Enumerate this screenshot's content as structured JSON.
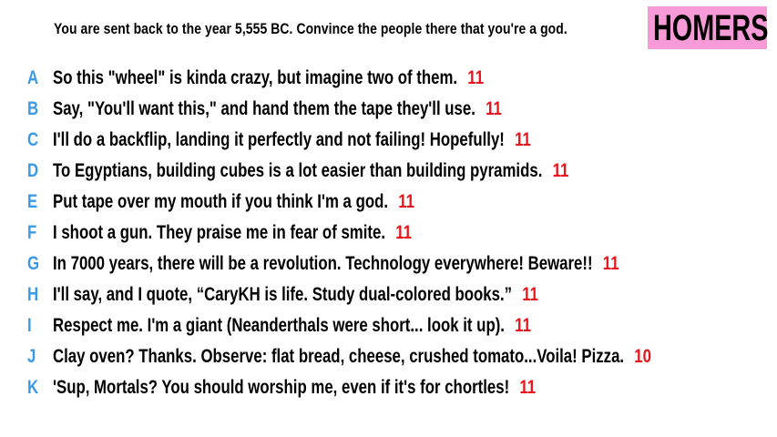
{
  "prompt": "You are sent back to the year 5,555 BC. Convince the people there that you're a god.",
  "badge": {
    "label": "HOMERS",
    "color": "#f79bd8"
  },
  "colors": {
    "letter": "#3b9ae6",
    "score": "#e8141c",
    "text": "#000000"
  },
  "answers": [
    {
      "letter": "A",
      "text": "So this \"wheel\" is kinda crazy, but imagine two of them.",
      "score": "11"
    },
    {
      "letter": "B",
      "text": "Say, \"You'll want this,\" and hand them the tape they'll use.",
      "score": "11"
    },
    {
      "letter": "C",
      "text": "I'll do a backflip, landing it perfectly and not failing! Hopefully!",
      "score": "11"
    },
    {
      "letter": "D",
      "text": "To Egyptians, building cubes is a lot easier than building pyramids.",
      "score": "11"
    },
    {
      "letter": "E",
      "text": "Put tape over my mouth if you think I'm a god.",
      "score": "11"
    },
    {
      "letter": "F",
      "text": "I shoot a gun. They praise me in fear of smite.",
      "score": "11"
    },
    {
      "letter": "G",
      "text": "In 7000 years, there will be a revolution. Technology everywhere! Beware!!",
      "score": "11"
    },
    {
      "letter": "H",
      "text": "I'll say, and I quote, “CaryKH is life. Study dual-colored books.”",
      "score": "11"
    },
    {
      "letter": "I",
      "text": "Respect me. I'm a giant (Neanderthals were short... look it up).",
      "score": "11"
    },
    {
      "letter": "J",
      "text": "Clay oven? Thanks. Observe: flat bread, cheese, crushed tomato...Voila! Pizza.",
      "score": "10"
    },
    {
      "letter": "K",
      "text": "'Sup, Mortals? You should worship me, even if it's for chortles!",
      "score": "11"
    }
  ]
}
